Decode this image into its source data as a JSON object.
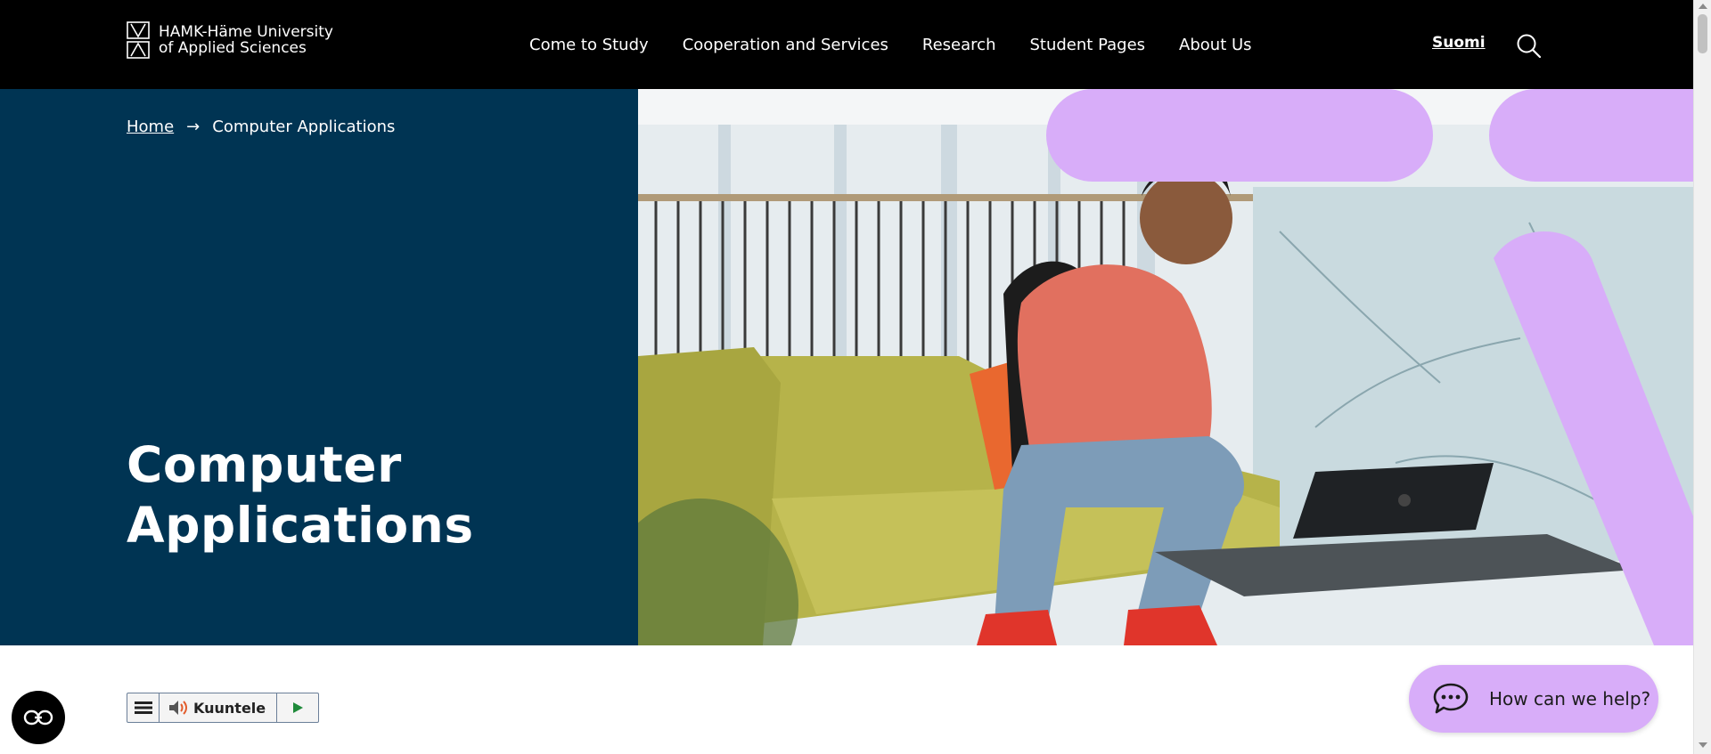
{
  "header": {
    "logo_line1": "HAMK-Häme University",
    "logo_line2": "of Applied Sciences",
    "nav": [
      "Come to Study",
      "Cooperation and Services",
      "Research",
      "Student Pages",
      "About Us"
    ],
    "language": "Suomi"
  },
  "breadcrumb": {
    "home": "Home",
    "arrow": "→",
    "current": "Computer Applications"
  },
  "hero": {
    "title_line1": "Computer",
    "title_line2": "Applications"
  },
  "listen": {
    "label": "Kuuntele"
  },
  "chat": {
    "label": "How can we help?"
  },
  "colors": {
    "header_bg": "#000000",
    "hero_bg": "#003453",
    "accent_purple": "#d8adf9"
  }
}
